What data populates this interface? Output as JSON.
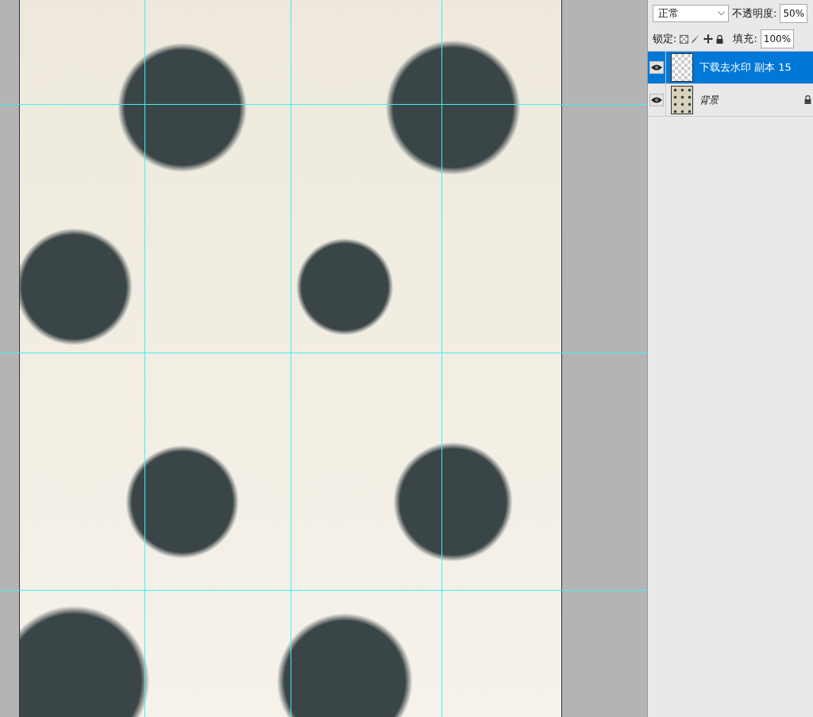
{
  "blend_mode": {
    "value": "正常"
  },
  "opacity": {
    "label": "不透明度:",
    "value": "50%"
  },
  "lock": {
    "label": "锁定:"
  },
  "fill": {
    "label": "填充:",
    "value": "100%"
  },
  "layers": [
    {
      "name": "下载去水印 副本 15",
      "selected": true,
      "visible": true,
      "locked": false,
      "kind": "transparent"
    },
    {
      "name": "背景",
      "selected": false,
      "visible": true,
      "locked": true,
      "kind": "image"
    }
  ]
}
